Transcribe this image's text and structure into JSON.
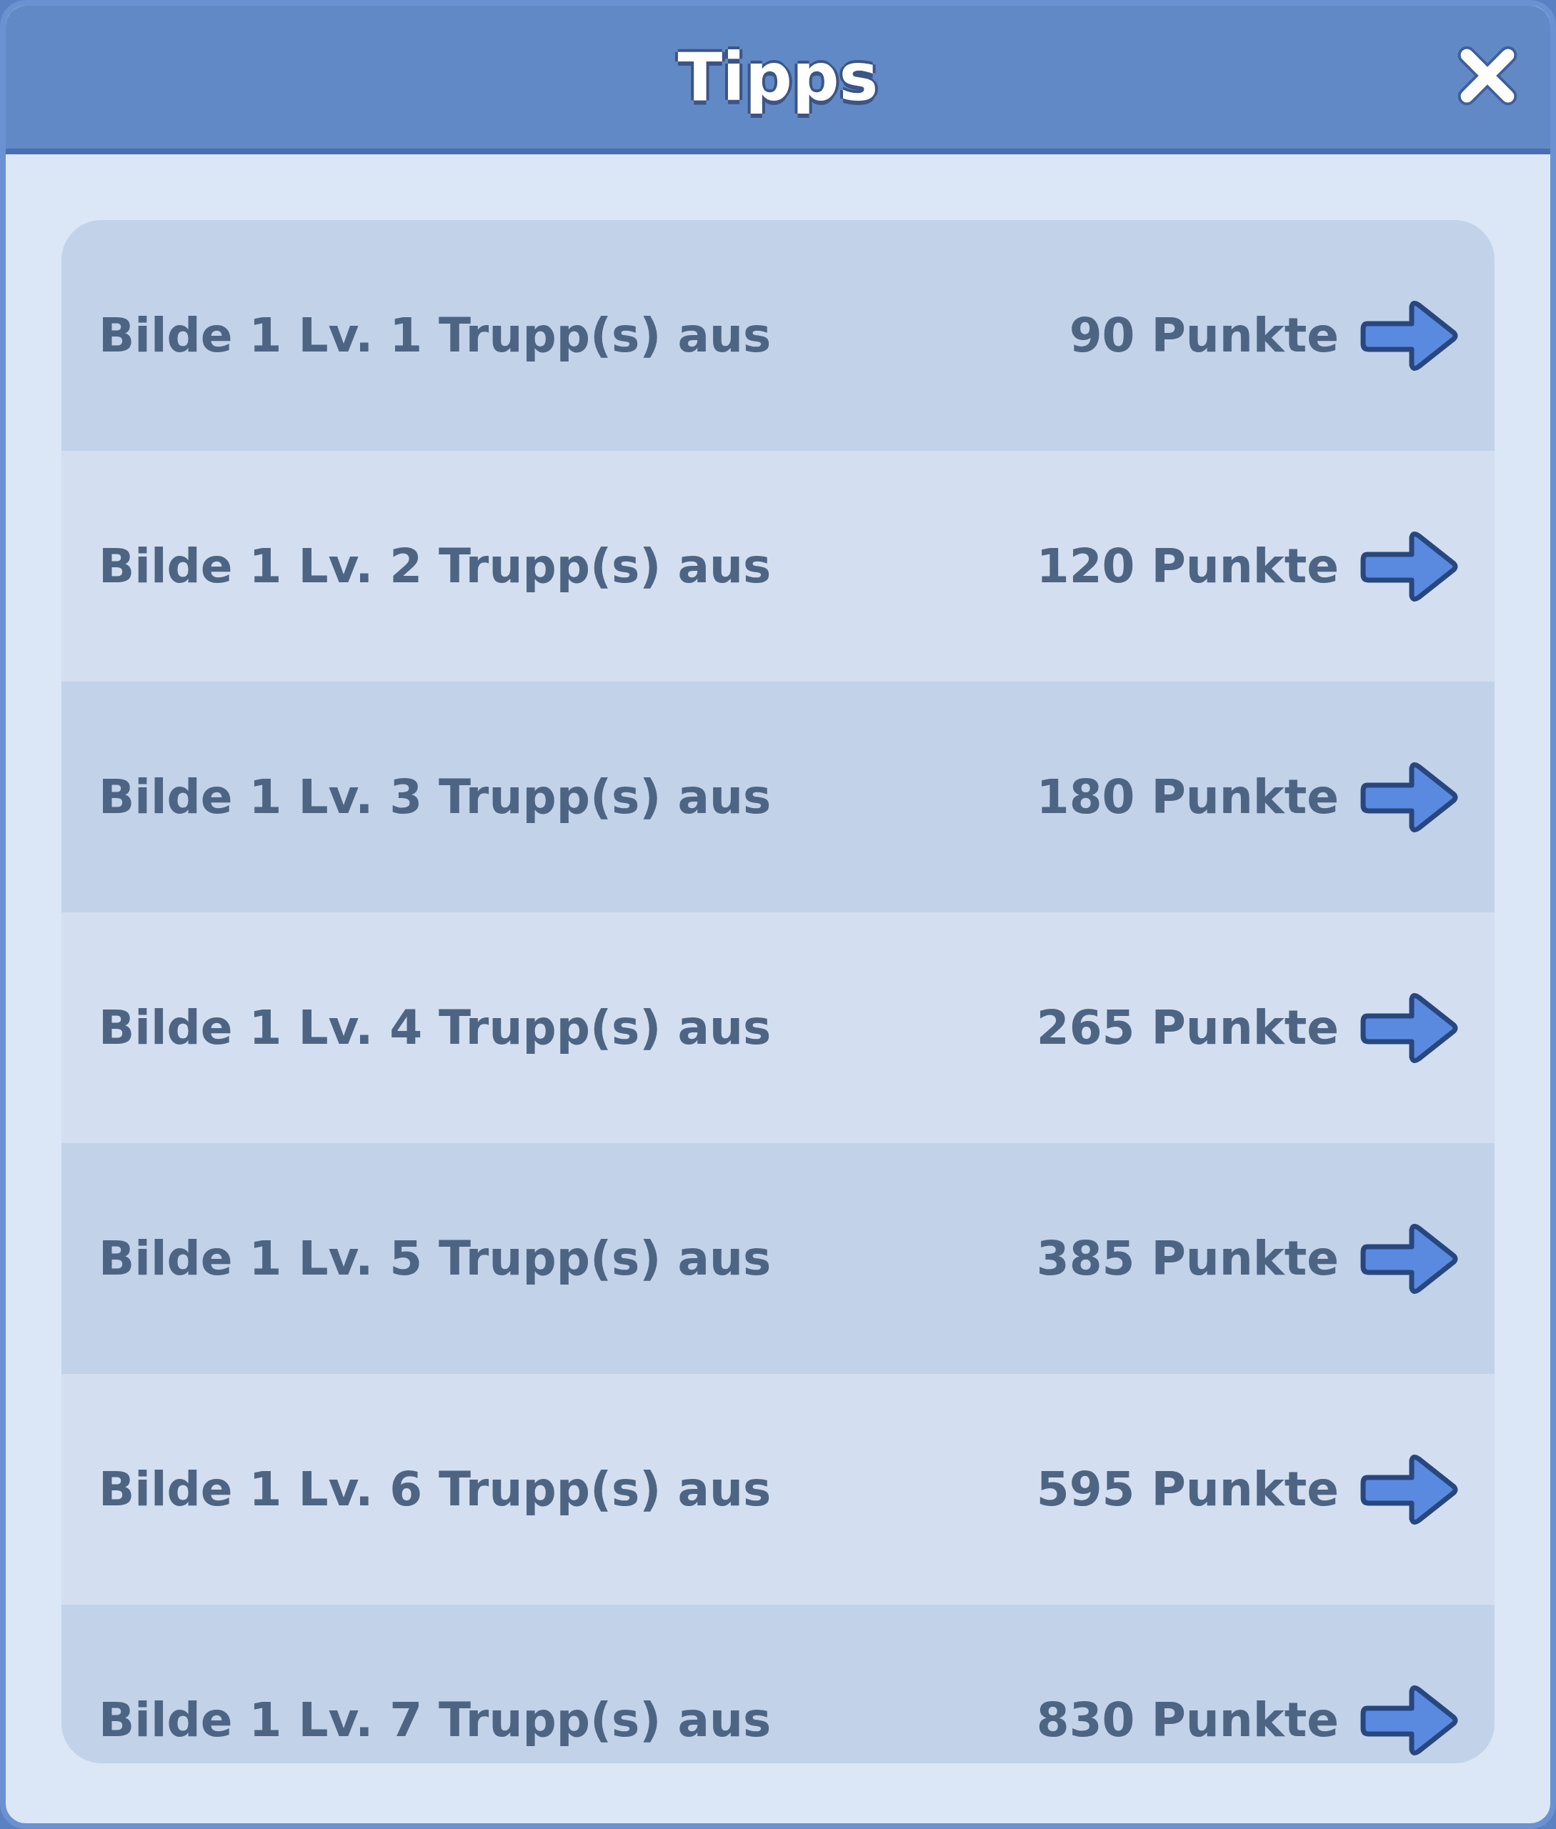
{
  "dialog": {
    "title": "Tipps"
  },
  "tips": [
    {
      "label": "Bilde 1 Lv. 1 Trupp(s) aus",
      "points": "90 Punkte"
    },
    {
      "label": "Bilde 1 Lv. 2 Trupp(s) aus",
      "points": "120 Punkte"
    },
    {
      "label": "Bilde 1 Lv. 3 Trupp(s) aus",
      "points": "180 Punkte"
    },
    {
      "label": "Bilde 1 Lv. 4 Trupp(s) aus",
      "points": "265 Punkte"
    },
    {
      "label": "Bilde 1 Lv. 5 Trupp(s) aus",
      "points": "385 Punkte"
    },
    {
      "label": "Bilde 1 Lv. 6 Trupp(s) aus",
      "points": "595 Punkte"
    },
    {
      "label": "Bilde 1 Lv. 7 Trupp(s) aus",
      "points": "830 Punkte"
    }
  ]
}
